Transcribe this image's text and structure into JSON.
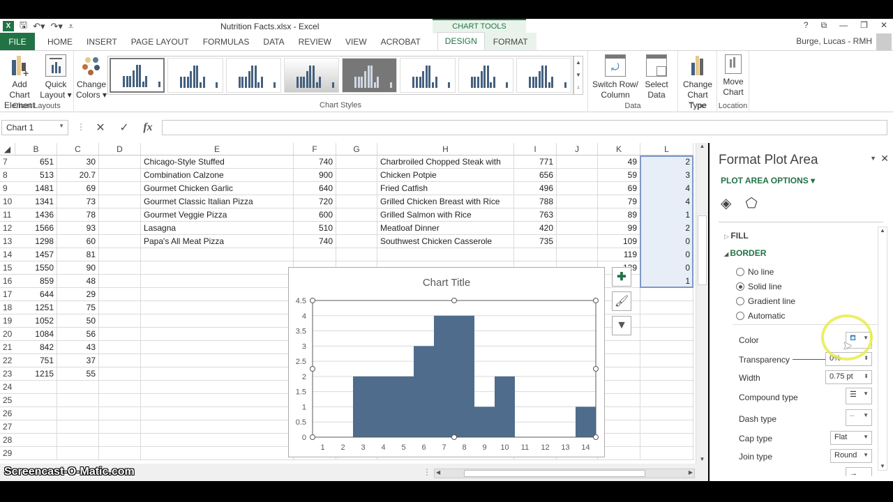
{
  "window": {
    "title": "Nutrition Facts.xlsx - Excel",
    "context_tab_group": "CHART TOOLS",
    "user": "Burge, Lucas - RMH",
    "controls": [
      "?",
      "⧉",
      "—",
      "❐",
      "✕"
    ]
  },
  "tabs": [
    {
      "label": "FILE"
    },
    {
      "label": "HOME"
    },
    {
      "label": "INSERT"
    },
    {
      "label": "PAGE LAYOUT"
    },
    {
      "label": "FORMULAS"
    },
    {
      "label": "DATA"
    },
    {
      "label": "REVIEW"
    },
    {
      "label": "VIEW"
    },
    {
      "label": "ACROBAT"
    },
    {
      "label": "DESIGN",
      "active": true
    },
    {
      "label": "FORMAT"
    }
  ],
  "ribbon": {
    "groups": {
      "chart_layouts": "Chart Layouts",
      "chart_styles": "Chart Styles",
      "data": "Data",
      "type": "Type",
      "location": "Location"
    },
    "buttons": {
      "add_chart_element": [
        "Add Chart",
        "Element ▾"
      ],
      "quick_layout": [
        "Quick",
        "Layout ▾"
      ],
      "change_colors": [
        "Change",
        "Colors ▾"
      ],
      "switch_row_column": [
        "Switch Row/",
        "Column"
      ],
      "select_data": [
        "Select",
        "Data"
      ],
      "change_chart_type": [
        "Change",
        "Chart Type"
      ],
      "move_chart": [
        "Move",
        "Chart"
      ]
    }
  },
  "formula_bar": {
    "name_box": "Chart 1",
    "cancel_icon": "✕",
    "enter_icon": "✓",
    "fx_icon": "fx",
    "formula": ""
  },
  "columns": [
    "B",
    "C",
    "D",
    "E",
    "F",
    "G",
    "H",
    "I",
    "J",
    "K",
    "L"
  ],
  "rows": [
    {
      "n": "7",
      "B": "651",
      "C": "30",
      "E": "Chicago-Style Stuffed",
      "F": "740",
      "H": "Charbroiled Chopped Steak with",
      "I": "771",
      "K": "49",
      "L": "2"
    },
    {
      "n": "8",
      "B": "513",
      "C": "20.7",
      "E": "Combination Calzone",
      "F": "900",
      "H": "Chicken Potpie",
      "I": "656",
      "K": "59",
      "L": "3"
    },
    {
      "n": "9",
      "B": "1481",
      "C": "69",
      "E": "Gourmet Chicken Garlic",
      "F": "640",
      "H": "Fried Catfish",
      "I": "496",
      "K": "69",
      "L": "4"
    },
    {
      "n": "10",
      "B": "1341",
      "C": "73",
      "E": "Gourmet Classic Italian Pizza",
      "F": "720",
      "H": "Grilled Chicken Breast with Rice",
      "I": "788",
      "K": "79",
      "L": "4"
    },
    {
      "n": "11",
      "B": "1436",
      "C": "78",
      "E": "Gourmet Veggie Pizza",
      "F": "600",
      "H": "Grilled Salmon with Rice",
      "I": "763",
      "K": "89",
      "L": "1"
    },
    {
      "n": "12",
      "B": "1566",
      "C": "93",
      "E": "Lasagna",
      "F": "510",
      "H": "Meatloaf Dinner",
      "I": "420",
      "K": "99",
      "L": "2"
    },
    {
      "n": "13",
      "B": "1298",
      "C": "60",
      "E": "Papa's All Meat Pizza",
      "F": "740",
      "H": "Southwest Chicken Casserole",
      "I": "735",
      "K": "109",
      "L": "0"
    },
    {
      "n": "14",
      "B": "1457",
      "C": "81",
      "E": "",
      "F": "",
      "H": "",
      "I": "",
      "K": "119",
      "L": "0"
    },
    {
      "n": "15",
      "B": "1550",
      "C": "90",
      "E": "",
      "F": "",
      "H": "",
      "I": "",
      "K": "129",
      "L": "0"
    },
    {
      "n": "16",
      "B": "859",
      "C": "48",
      "E": "",
      "F": "",
      "H": "",
      "I": "",
      "K": "",
      "L": "1"
    },
    {
      "n": "17",
      "B": "644",
      "C": "29"
    },
    {
      "n": "18",
      "B": "1251",
      "C": "75"
    },
    {
      "n": "19",
      "B": "1052",
      "C": "50"
    },
    {
      "n": "20",
      "B": "1084",
      "C": "56"
    },
    {
      "n": "21",
      "B": "842",
      "C": "43"
    },
    {
      "n": "22",
      "B": "751",
      "C": "37"
    },
    {
      "n": "23",
      "B": "1215",
      "C": "55"
    },
    {
      "n": "24"
    },
    {
      "n": "25"
    },
    {
      "n": "26"
    },
    {
      "n": "27"
    },
    {
      "n": "28"
    },
    {
      "n": "29"
    }
  ],
  "chart_data": {
    "type": "bar",
    "title": "Chart Title",
    "categories": [
      "1",
      "2",
      "3",
      "4",
      "5",
      "6",
      "7",
      "8",
      "9",
      "10",
      "11",
      "12",
      "13",
      "14"
    ],
    "values": [
      0,
      0,
      2,
      2,
      2,
      3,
      4,
      4,
      1,
      2,
      0,
      0,
      0,
      1
    ],
    "ylim": [
      0,
      4.5
    ],
    "yticks": [
      "0",
      "0.5",
      "1",
      "1.5",
      "2",
      "2.5",
      "3",
      "3.5",
      "4",
      "4.5"
    ],
    "xlabel": "",
    "ylabel": "",
    "gap_width": 0,
    "bar_color": "#4f6c8c",
    "grid": true,
    "legend": "none"
  },
  "chart_side_buttons": [
    "+",
    "brush",
    "filter"
  ],
  "format_pane": {
    "title": "Format Plot Area",
    "subtitle": "PLOT AREA OPTIONS ▾",
    "sections": {
      "fill": "FILL",
      "border": "BORDER"
    },
    "border_options": [
      {
        "label": "No line",
        "selected": false
      },
      {
        "label": "Solid line",
        "selected": true
      },
      {
        "label": "Gradient line",
        "selected": false
      },
      {
        "label": "Automatic",
        "selected": false
      }
    ],
    "props": {
      "color": "Color",
      "transparency": "Transparency",
      "transparency_value": "0%",
      "width": "Width",
      "width_value": "0.75 pt",
      "compound": "Compound type",
      "dash": "Dash type",
      "cap": "Cap type",
      "cap_value": "Flat",
      "join": "Join type",
      "join_value": "Round"
    }
  },
  "watermark": "Screencast-O-Matic.com",
  "accent": "#217346"
}
